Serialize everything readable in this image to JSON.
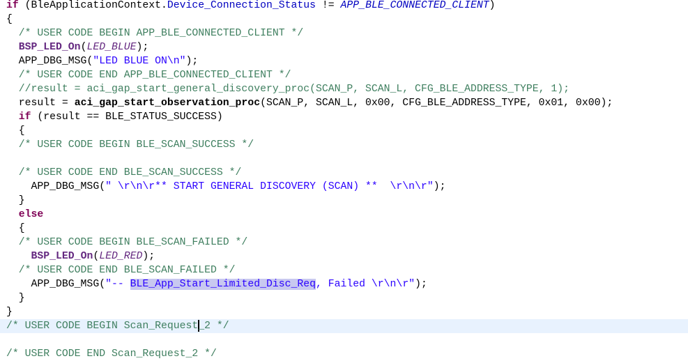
{
  "editor": {
    "current_line": 23,
    "lines": [
      [
        [
          "if",
          "kw"
        ],
        [
          " (BleApplicationContext.",
          ""
        ],
        [
          "Device_Connection_Status",
          "fd"
        ],
        [
          " != ",
          ""
        ],
        [
          "APP_BLE_CONNECTED_CLIENT",
          "mc"
        ],
        [
          ")",
          ""
        ]
      ],
      [
        [
          "{",
          ""
        ]
      ],
      [
        [
          "  ",
          ""
        ],
        [
          "/* USER CODE BEGIN APP_BLE_CONNECTED_CLIENT */",
          "cm"
        ]
      ],
      [
        [
          "  ",
          ""
        ],
        [
          "BSP_LED_On",
          "fn"
        ],
        [
          "(",
          ""
        ],
        [
          "LED_BLUE",
          "it"
        ],
        [
          ");",
          ""
        ]
      ],
      [
        [
          "  APP_DBG_MSG(",
          ""
        ],
        [
          "\"LED BLUE ON\\n\"",
          "st"
        ],
        [
          ");",
          ""
        ]
      ],
      [
        [
          "  ",
          ""
        ],
        [
          "/* USER CODE END APP_BLE_CONNECTED_CLIENT */",
          "cm"
        ]
      ],
      [
        [
          "  ",
          ""
        ],
        [
          "//result = aci_gap_start_general_discovery_proc(SCAN_P, SCAN_L, CFG_BLE_ADDRESS_TYPE, 1);",
          "cm"
        ]
      ],
      [
        [
          "  result = ",
          ""
        ],
        [
          "aci_gap_start_observation_proc",
          "fn2"
        ],
        [
          "(SCAN_P, SCAN_L, 0x00, CFG_BLE_ADDRESS_TYPE, 0x01, 0x00);",
          ""
        ]
      ],
      [
        [
          "  ",
          ""
        ],
        [
          "if",
          "kw"
        ],
        [
          " (result == BLE_STATUS_SUCCESS)",
          ""
        ]
      ],
      [
        [
          "  {",
          ""
        ]
      ],
      [
        [
          "  ",
          ""
        ],
        [
          "/* USER CODE BEGIN BLE_SCAN_SUCCESS */",
          "cm"
        ]
      ],
      [],
      [
        [
          "  ",
          ""
        ],
        [
          "/* USER CODE END BLE_SCAN_SUCCESS */",
          "cm"
        ]
      ],
      [
        [
          "    APP_DBG_MSG(",
          ""
        ],
        [
          "\" \\r\\n\\r** START GENERAL DISCOVERY (SCAN) **  \\r\\n\\r\"",
          "st"
        ],
        [
          ");",
          ""
        ]
      ],
      [
        [
          "  }",
          ""
        ]
      ],
      [
        [
          "  ",
          ""
        ],
        [
          "else",
          "kw"
        ]
      ],
      [
        [
          "  {",
          ""
        ]
      ],
      [
        [
          "  ",
          ""
        ],
        [
          "/* USER CODE BEGIN BLE_SCAN_FAILED */",
          "cm"
        ]
      ],
      [
        [
          "    ",
          ""
        ],
        [
          "BSP_LED_On",
          "fn"
        ],
        [
          "(",
          ""
        ],
        [
          "LED_RED",
          "it"
        ],
        [
          ");",
          ""
        ]
      ],
      [
        [
          "  ",
          ""
        ],
        [
          "/* USER CODE END BLE_SCAN_FAILED */",
          "cm"
        ]
      ],
      [
        [
          "    APP_DBG_MSG(",
          ""
        ],
        [
          "\"-- ",
          "st"
        ],
        [
          "BLE_App_Start_Limited_Disc_Req",
          "st sel"
        ],
        [
          ", Failed \\r\\n\\r\"",
          "st"
        ],
        [
          ");",
          ""
        ]
      ],
      [
        [
          "  }",
          ""
        ]
      ],
      [
        [
          "}",
          ""
        ]
      ],
      [
        [
          "/* USER CODE BEGIN Scan_Request",
          "cm"
        ],
        [
          "",
          "caret"
        ],
        [
          "_2 */",
          "cm"
        ]
      ],
      [],
      [
        [
          "/* USER CODE END Scan_Request_2 */",
          "cm"
        ]
      ]
    ]
  }
}
